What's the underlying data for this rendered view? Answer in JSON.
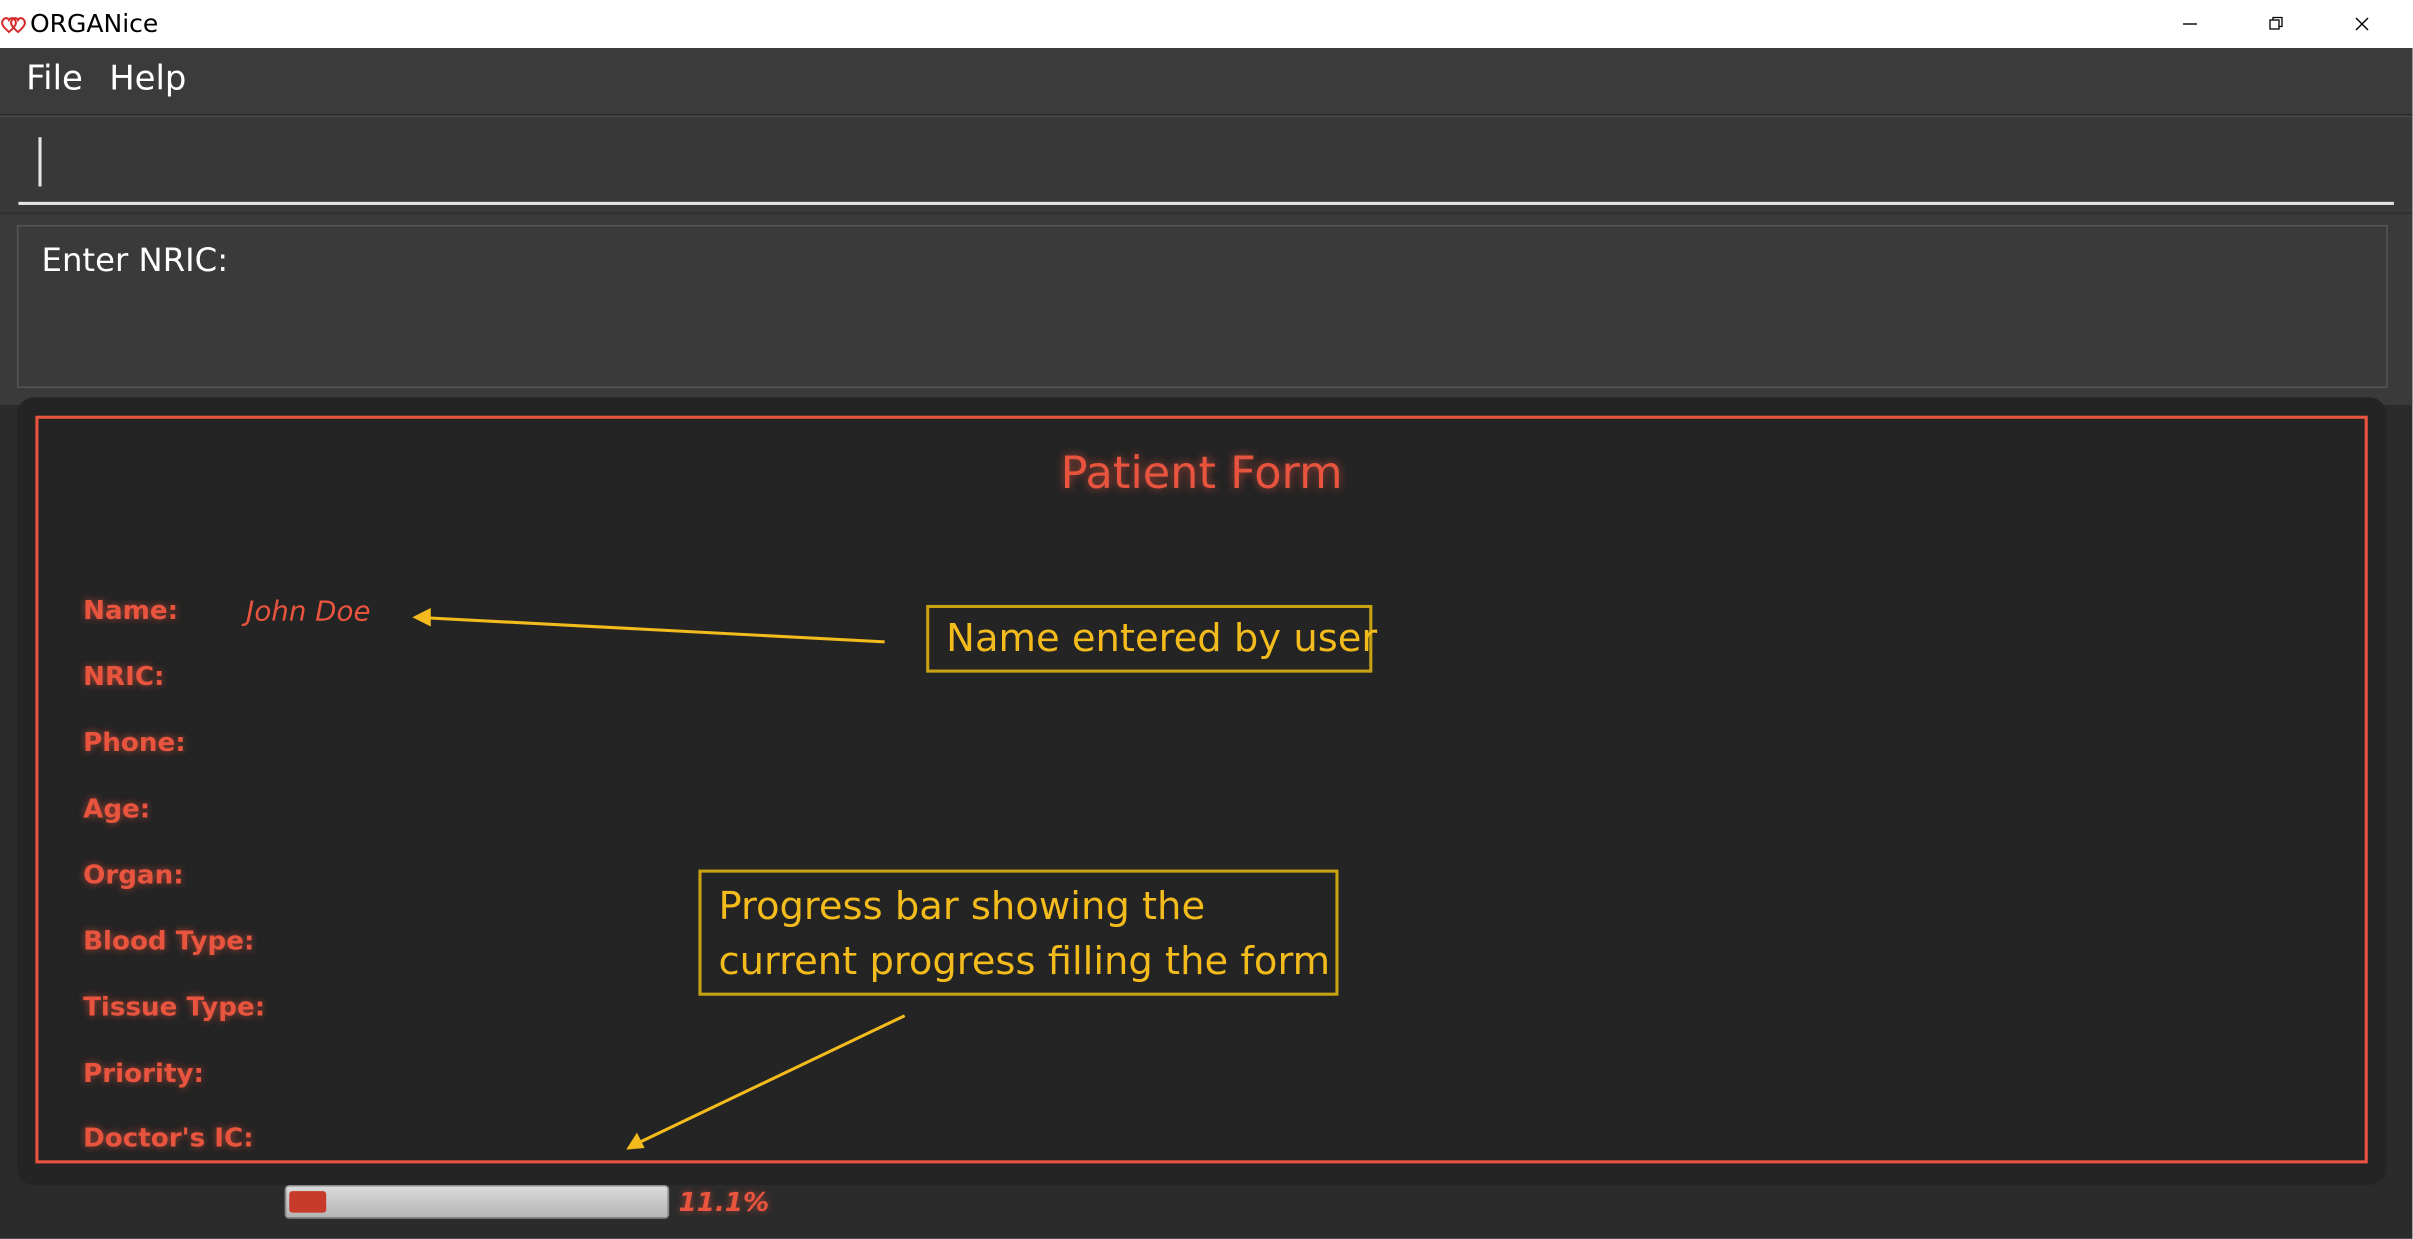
{
  "window": {
    "title": "ORGANice",
    "icon": "double-heart-icon",
    "controls": [
      "minimize-icon",
      "restore-icon",
      "close-icon"
    ]
  },
  "menu": {
    "file_label": "File",
    "help_label": "Help"
  },
  "command_box": {
    "value": ""
  },
  "result_display": {
    "text": "Enter NRIC:"
  },
  "form": {
    "title": "Patient Form",
    "fields": {
      "name": {
        "label": "Name:",
        "value": "John Doe"
      },
      "nric": {
        "label": "NRIC:",
        "value": ""
      },
      "phone": {
        "label": "Phone:",
        "value": ""
      },
      "age": {
        "label": "Age:",
        "value": ""
      },
      "organ": {
        "label": "Organ:",
        "value": ""
      },
      "blood_type": {
        "label": "Blood Type:",
        "value": ""
      },
      "tissue_type": {
        "label": "Tissue Type:",
        "value": ""
      },
      "priority": {
        "label": "Priority:",
        "value": ""
      },
      "doctor_ic": {
        "label": "Doctor's IC:",
        "value": ""
      }
    },
    "progress": {
      "fraction": 0.111,
      "text": "11.1%"
    }
  },
  "annotations": {
    "name_note": "Name entered by user",
    "progress_note_line1": "Progress bar showing the",
    "progress_note_line2": "current progress filling the form"
  },
  "colors": {
    "accent": "#e8543e",
    "annotation": "#f4bb1c",
    "background": "#2b2b2b",
    "progress_fill": "#c83a2a"
  }
}
